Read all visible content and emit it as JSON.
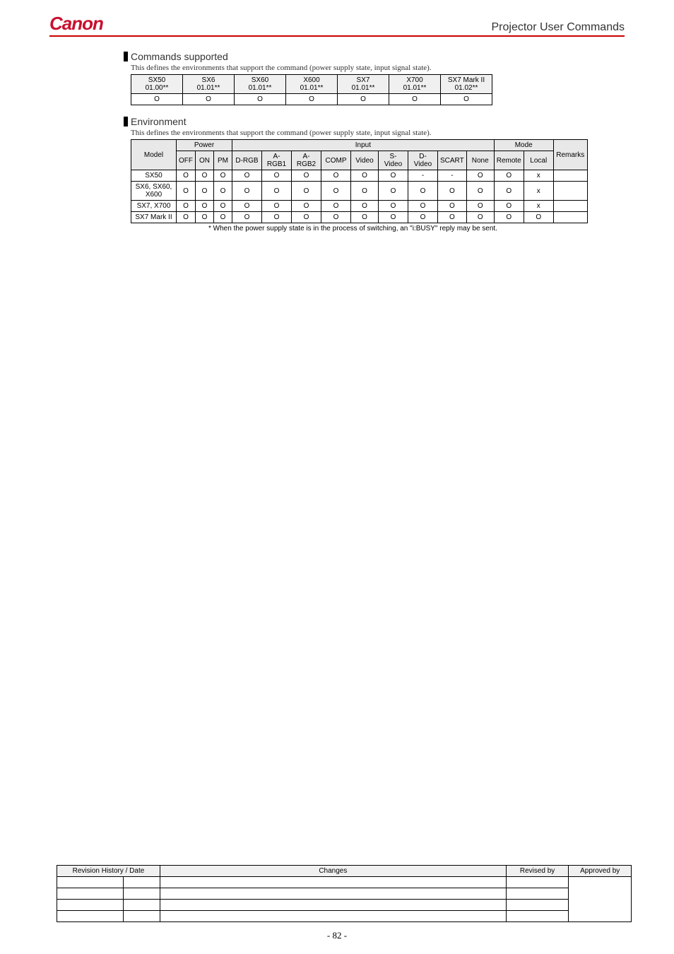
{
  "header": {
    "title": "Projector User Commands"
  },
  "sections": {
    "commands_supported": {
      "title": "Commands supported",
      "desc": "This defines the environments that support the command (power supply state, input signal state).",
      "headers": [
        {
          "model": "SX50",
          "ver": "01.00**"
        },
        {
          "model": "SX6",
          "ver": "01.01**"
        },
        {
          "model": "SX60",
          "ver": "01.01**"
        },
        {
          "model": "X600",
          "ver": "01.01**"
        },
        {
          "model": "SX7",
          "ver": "01.01**"
        },
        {
          "model": "X700",
          "ver": "01.01**"
        },
        {
          "model": "SX7 Mark II",
          "ver": "01.02**"
        }
      ],
      "values": [
        "O",
        "O",
        "O",
        "O",
        "O",
        "O",
        "O"
      ]
    },
    "environment": {
      "title": "Environment",
      "desc": "This defines the environments that support the command (power supply state, input signal state).",
      "group_headers": {
        "model": "Model",
        "power": "Power",
        "input": "Input",
        "mode": "Mode",
        "remarks": "Remarks"
      },
      "col_headers": {
        "off": "OFF",
        "on": "ON",
        "pm": "PM",
        "drgb": "D-RGB",
        "argb1": "A-RGB1",
        "argb2": "A-RGB2",
        "comp": "COMP",
        "video": "Video",
        "svideo": "S-Video",
        "dvideo": "D-Video",
        "scart": "SCART",
        "none": "None",
        "remote": "Remote",
        "local": "Local"
      },
      "rows": [
        {
          "model": "SX50",
          "cells": [
            "O",
            "O",
            "O",
            "O",
            "O",
            "O",
            "O",
            "O",
            "O",
            "-",
            "-",
            "O",
            "O",
            "x",
            ""
          ]
        },
        {
          "model": "SX6, SX60, X600",
          "cells": [
            "O",
            "O",
            "O",
            "O",
            "O",
            "O",
            "O",
            "O",
            "O",
            "O",
            "O",
            "O",
            "O",
            "x",
            ""
          ]
        },
        {
          "model": "SX7, X700",
          "cells": [
            "O",
            "O",
            "O",
            "O",
            "O",
            "O",
            "O",
            "O",
            "O",
            "O",
            "O",
            "O",
            "O",
            "x",
            ""
          ]
        },
        {
          "model": "SX7 Mark II",
          "cells": [
            "O",
            "O",
            "O",
            "O",
            "O",
            "O",
            "O",
            "O",
            "O",
            "O",
            "O",
            "O",
            "O",
            "O",
            ""
          ]
        }
      ],
      "footnote": "*  When the power supply state is in the process of switching, an \"i:BUSY\" reply may be sent."
    }
  },
  "revision": {
    "headers": {
      "hist": "Revision History / Date",
      "changes": "Changes",
      "revised": "Revised by",
      "approved": "Approved by"
    }
  },
  "page_number": "- 82 -",
  "chart_data": {
    "type": "table",
    "title": "Commands Supported / Environment Matrix",
    "commands_supported": {
      "columns": [
        "SX50 01.00**",
        "SX6 01.01**",
        "SX60 01.01**",
        "X600 01.01**",
        "SX7 01.01**",
        "X700 01.01**",
        "SX7 Mark II 01.02**"
      ],
      "row": [
        "O",
        "O",
        "O",
        "O",
        "O",
        "O",
        "O"
      ]
    },
    "environment": {
      "columns": [
        "Model",
        "OFF",
        "ON",
        "PM",
        "D-RGB",
        "A-RGB1",
        "A-RGB2",
        "COMP",
        "Video",
        "S-Video",
        "D-Video",
        "SCART",
        "None",
        "Remote",
        "Local",
        "Remarks"
      ],
      "rows": [
        [
          "SX50",
          "O",
          "O",
          "O",
          "O",
          "O",
          "O",
          "O",
          "O",
          "O",
          "-",
          "-",
          "O",
          "O",
          "x",
          ""
        ],
        [
          "SX6, SX60, X600",
          "O",
          "O",
          "O",
          "O",
          "O",
          "O",
          "O",
          "O",
          "O",
          "O",
          "O",
          "O",
          "O",
          "x",
          ""
        ],
        [
          "SX7, X700",
          "O",
          "O",
          "O",
          "O",
          "O",
          "O",
          "O",
          "O",
          "O",
          "O",
          "O",
          "O",
          "O",
          "x",
          ""
        ],
        [
          "SX7 Mark II",
          "O",
          "O",
          "O",
          "O",
          "O",
          "O",
          "O",
          "O",
          "O",
          "O",
          "O",
          "O",
          "O",
          "O",
          ""
        ]
      ]
    }
  }
}
